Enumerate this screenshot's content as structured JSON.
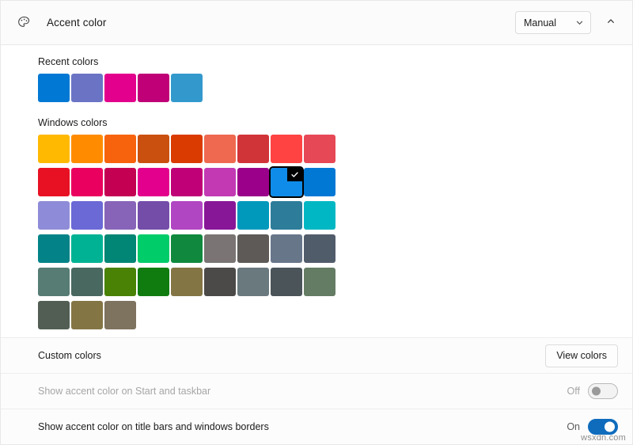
{
  "header": {
    "icon": "palette-icon",
    "title": "Accent color",
    "mode_dropdown": {
      "value": "Manual",
      "chevron": "chevron-down-icon"
    },
    "collapse": "chevron-up-icon"
  },
  "recent": {
    "label": "Recent colors",
    "colors": [
      "#0078d4",
      "#6b74c4",
      "#e3008c",
      "#bf0077",
      "#3399cc"
    ]
  },
  "windows": {
    "label": "Windows colors",
    "selected_index": 16,
    "rows": [
      [
        "#ffb900",
        "#ff8c00",
        "#f7630c",
        "#ca5010",
        "#da3b01",
        "#ef6950",
        "#d13438",
        "#ff4343",
        "#e74856"
      ],
      [
        "#e81123",
        "#ea005e",
        "#c30052",
        "#e3008c",
        "#bf0077",
        "#c239b3",
        "#9a0089",
        "#0f8ce9",
        "#0078d4"
      ],
      [
        "#8e8cd8",
        "#6b69d6",
        "#8764b8",
        "#744da9",
        "#b146c2",
        "#881798",
        "#0099bc",
        "#2d7d9a",
        "#00b7c3"
      ],
      [
        "#038387",
        "#00b294",
        "#018574",
        "#00cc6a",
        "#10893e",
        "#7a7574",
        "#5d5a58",
        "#68768a",
        "#515c6b"
      ],
      [
        "#567c73",
        "#486860",
        "#498205",
        "#107c10",
        "#847545",
        "#4c4a48",
        "#69797e",
        "#4a5459",
        "#647c64"
      ],
      [
        "#525e54",
        "#847545",
        "#7e735f"
      ]
    ]
  },
  "custom": {
    "label": "Custom colors",
    "view_button": "View colors"
  },
  "settings": [
    {
      "label": "Show accent color on Start and taskbar",
      "state_text": "Off",
      "on": false,
      "disabled": true
    },
    {
      "label": "Show accent color on title bars and windows borders",
      "state_text": "On",
      "on": true,
      "disabled": false
    }
  ],
  "watermark": "wsxdn.com",
  "accent_color": "#0f6cbd"
}
